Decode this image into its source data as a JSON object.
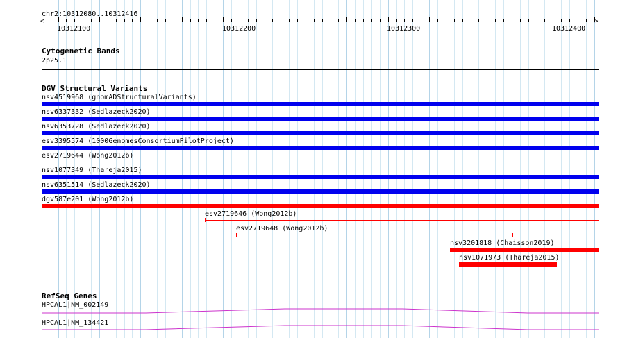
{
  "ruler": {
    "location_label": "chr2:10312080..10312416",
    "tick_labels": [
      "10312100",
      "10312200",
      "10312300",
      "10312400"
    ]
  },
  "cytoband": {
    "title": "Cytogenetic Bands",
    "band_label": "2p25.1"
  },
  "dgv": {
    "title": "DGV Structural Variants",
    "features": [
      {
        "label": "nsv4519968 (gnomADStructuralVariants)",
        "color": "#0000ee"
      },
      {
        "label": "nsv6337332 (Sedlazeck2020)",
        "color": "#0000ee"
      },
      {
        "label": "nsv6353728 (Sedlazeck2020)",
        "color": "#0000ee"
      },
      {
        "label": "esv3395574 (1000GenomesConsortiumPilotProject)",
        "color": "#0000ee"
      },
      {
        "label": "esv2719644 (Wong2012b)",
        "color": "#ff0000"
      },
      {
        "label": "nsv1077349 (Thareja2015)",
        "color": "#0000ee"
      },
      {
        "label": "nsv6351514 (Sedlazeck2020)",
        "color": "#0000ee"
      },
      {
        "label": "dgv587e201 (Wong2012b)",
        "color": "#ff0000"
      },
      {
        "label": "esv2719646 (Wong2012b)",
        "color": "#ff0000"
      },
      {
        "label": "esv2719648 (Wong2012b)",
        "color": "#ff0000"
      },
      {
        "label": "nsv3201818 (Chaisson2019)",
        "color": "#ff0000"
      },
      {
        "label": "nsv1071973 (Thareja2015)",
        "color": "#ff0000"
      }
    ]
  },
  "refseq": {
    "title": "RefSeq Genes",
    "genes": [
      {
        "label": "HPCAL1|NM_002149",
        "color": "#cc33cc"
      },
      {
        "label": "HPCAL1|NM_134421",
        "color": "#cc33cc"
      }
    ]
  }
}
